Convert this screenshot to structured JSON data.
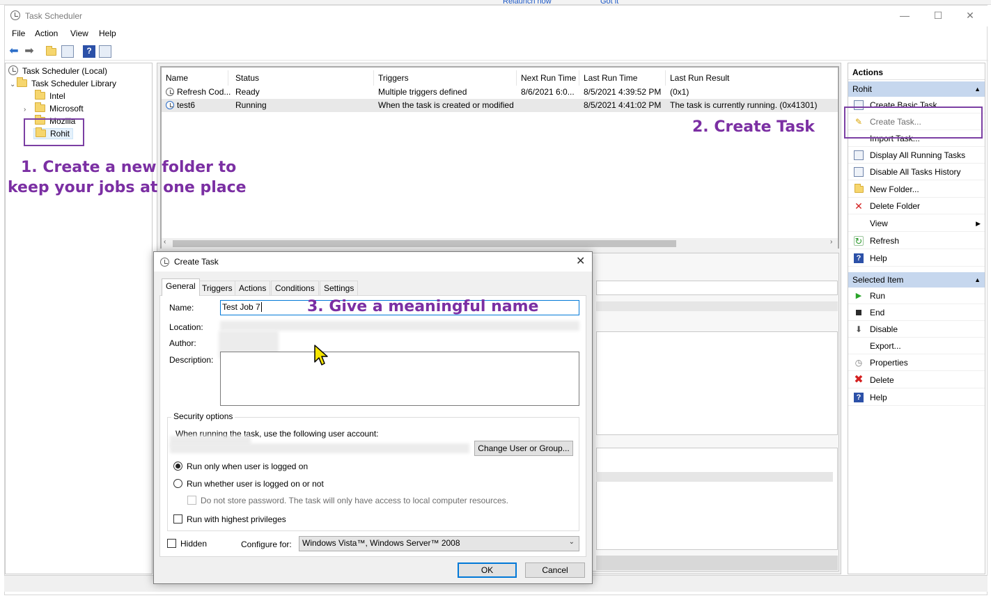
{
  "background_browser": {
    "relaunch": "Relaunch now",
    "gotit": "Got it"
  },
  "window": {
    "title": "Task Scheduler",
    "controls": {
      "minimize": "—",
      "maximize": "☐",
      "close": "✕"
    }
  },
  "menu": [
    "File",
    "Action",
    "View",
    "Help"
  ],
  "tree": {
    "root": "Task Scheduler (Local)",
    "library": "Task Scheduler Library",
    "folders": [
      "Intel",
      "Microsoft",
      "Mozilla",
      "Rohit"
    ]
  },
  "task_table": {
    "columns": [
      "Name",
      "Status",
      "Triggers",
      "Next Run Time",
      "Last Run Time",
      "Last Run Result"
    ],
    "rows": [
      [
        "Refresh Cod...",
        "Ready",
        "Multiple triggers defined",
        "8/6/2021 6:0...",
        "8/5/2021 4:39:52 PM",
        "(0x1)"
      ],
      [
        "test6",
        "Running",
        "When the task is created or modified",
        "",
        "8/5/2021 4:41:02 PM",
        "The task is currently running. (0x41301)"
      ]
    ]
  },
  "actions_pane": {
    "header": "Actions",
    "section1": {
      "title": "Rohit",
      "items": [
        "Create Basic Task...",
        "Create Task...",
        "Import Task...",
        "Display All Running Tasks",
        "Disable All Tasks History",
        "New Folder...",
        "Delete Folder",
        "View",
        "Refresh",
        "Help"
      ]
    },
    "section2": {
      "title": "Selected Item",
      "items": [
        "Run",
        "End",
        "Disable",
        "Export...",
        "Properties",
        "Delete",
        "Help"
      ]
    }
  },
  "annotations": {
    "step1_line1": "1. Create a new folder to",
    "step1_line2": "keep your jobs at one place",
    "step2": "2. Create Task",
    "step3": "3. Give a meaningful name",
    "color": "#7b2fa3"
  },
  "dialog": {
    "title": "Create Task",
    "close": "✕",
    "tabs": [
      "General",
      "Triggers",
      "Actions",
      "Conditions",
      "Settings"
    ],
    "fields": {
      "name_label": "Name:",
      "name_value": "Test Job 7",
      "location_label": "Location:",
      "author_label": "Author:",
      "description_label": "Description:"
    },
    "security": {
      "group_label": "Security options",
      "account_text": "When running the task, use the following user account:",
      "change_user_button": "Change User or Group...",
      "run_logged_on": "Run only when user is logged on",
      "run_whether": "Run whether user is logged on or not",
      "no_store_pw": "Do not store password.  The task will only have access to local computer resources.",
      "highest_priv": "Run with highest privileges"
    },
    "hidden_label": "Hidden",
    "configure_label": "Configure for:",
    "configure_value": "Windows Vista™, Windows Server™ 2008",
    "ok": "OK",
    "cancel": "Cancel"
  }
}
